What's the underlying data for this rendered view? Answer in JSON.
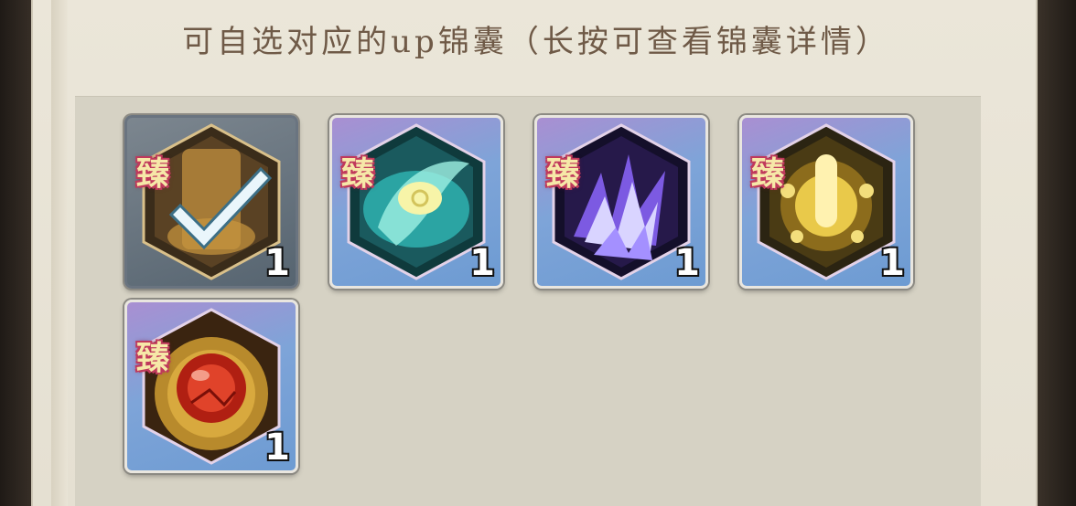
{
  "title": "可自选对应的up锦囊（长按可查看锦囊详情）",
  "items": [
    {
      "tag": "臻",
      "count": "1",
      "icon": "golden-scroll-icon",
      "selected": true
    },
    {
      "tag": "臻",
      "count": "1",
      "icon": "cyan-wind-icon",
      "selected": false
    },
    {
      "tag": "臻",
      "count": "1",
      "icon": "purple-crystal-icon",
      "selected": false
    },
    {
      "tag": "臻",
      "count": "1",
      "icon": "golden-sun-icon",
      "selected": false
    },
    {
      "tag": "臻",
      "count": "1",
      "icon": "red-orb-icon",
      "selected": false
    }
  ]
}
